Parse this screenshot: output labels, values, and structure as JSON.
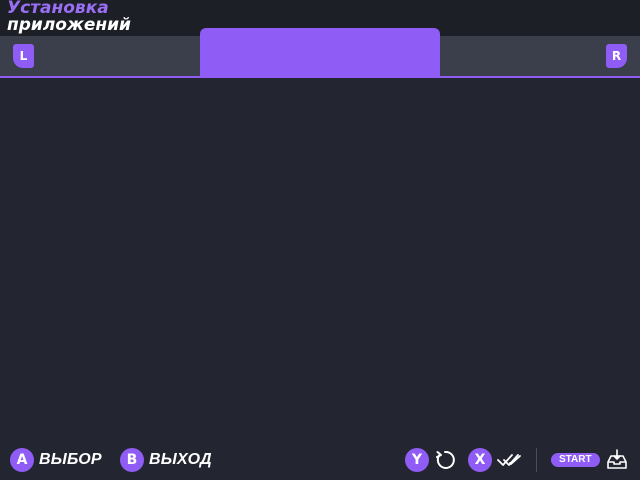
{
  "header": {
    "title_line1": "Установка",
    "title_line2": "приложений"
  },
  "tabbar": {
    "left_shoulder": "L",
    "right_shoulder": "R"
  },
  "footer": {
    "a_glyph": "A",
    "a_label": "ВЫБОР",
    "b_glyph": "B",
    "b_label": "ВЫХОД",
    "y_glyph": "Y",
    "y_icon": "refresh-icon",
    "x_glyph": "X",
    "x_icon": "double-check-icon",
    "start_label": "START",
    "start_icon": "tray-install-icon"
  },
  "colors": {
    "accent": "#8f5cf5",
    "background": "#232630",
    "header": "#1d1f27",
    "tabbar": "#3b3e4b"
  }
}
